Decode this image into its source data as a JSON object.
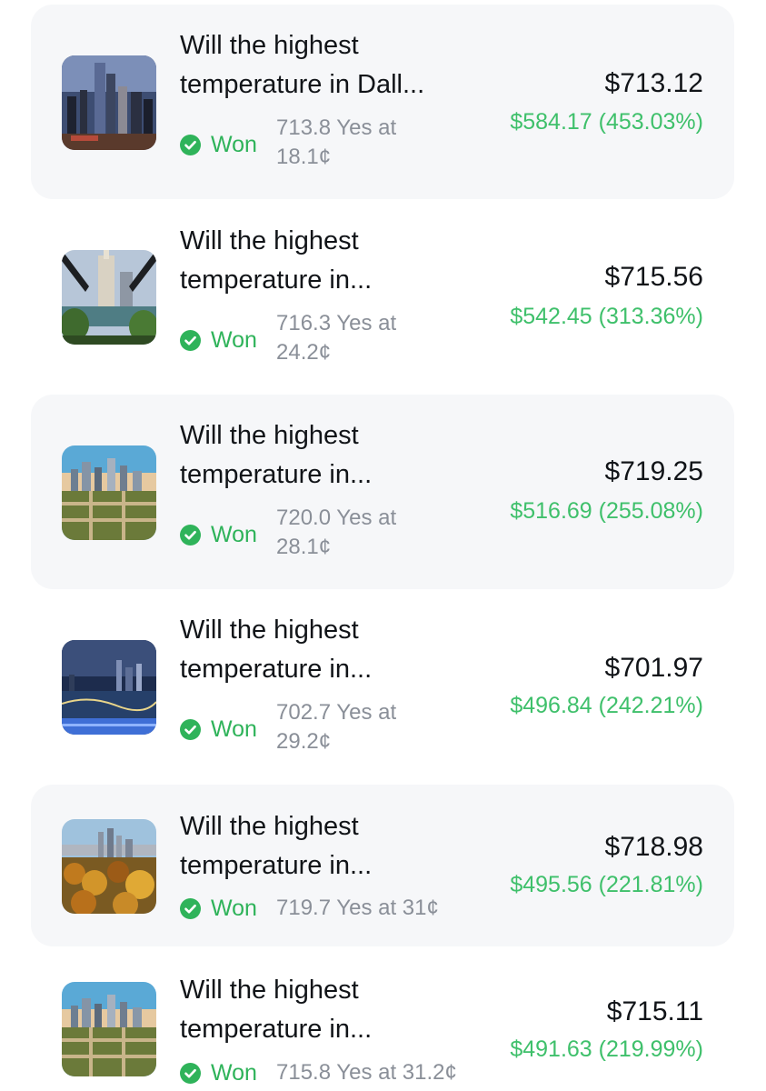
{
  "colors": {
    "card_bg": "#f6f7f9",
    "title": "#111418",
    "won_green": "#2fb35a",
    "gain_green": "#3fc06b",
    "detail_gray": "#8a8f98"
  },
  "positions": [
    {
      "title_line1": "Will the highest",
      "title_line2": "temperature in Dall...",
      "status": "Won",
      "status_icon": "check-circle-icon",
      "detail_line1": "713.8 Yes at",
      "detail_line2": "18.1¢",
      "value": "$713.12",
      "gain": "$584.17 (453.03%)",
      "image": "dallas-skyline-image"
    },
    {
      "title_line1": "Will the highest",
      "title_line2": "temperature in...",
      "status": "Won",
      "status_icon": "check-circle-icon",
      "detail_line1": "716.3 Yes at",
      "detail_line2": "24.2¢",
      "value": "$715.56",
      "gain": "$542.45 (313.36%)",
      "image": "chicago-bridge-image"
    },
    {
      "title_line1": "Will the highest",
      "title_line2": "temperature in...",
      "status": "Won",
      "status_icon": "check-circle-icon",
      "detail_line1": "720.0 Yes at",
      "detail_line2": "28.1¢",
      "value": "$719.25",
      "gain": "$516.69 (255.08%)",
      "image": "city-aerial-image"
    },
    {
      "title_line1": "Will the highest",
      "title_line2": "temperature in...",
      "status": "Won",
      "status_icon": "check-circle-icon",
      "detail_line1": "702.7 Yes at",
      "detail_line2": "29.2¢",
      "value": "$701.97",
      "gain": "$496.84 (242.21%)",
      "image": "night-city-river-image"
    },
    {
      "title_line1": "Will the highest",
      "title_line2": "temperature in...",
      "status": "Won",
      "status_icon": "check-circle-icon",
      "detail_line1": "719.7 Yes at 31¢",
      "detail_line2": "",
      "value": "$718.98",
      "gain": "$495.56 (221.81%)",
      "image": "autumn-city-image"
    },
    {
      "title_line1": "Will the highest",
      "title_line2": "temperature in...",
      "status": "Won",
      "status_icon": "check-circle-icon",
      "detail_line1": "715.8 Yes at 31.2¢",
      "detail_line2": "",
      "value": "$715.11",
      "gain": "$491.63 (219.99%)",
      "image": "city-aerial-image-2"
    }
  ]
}
